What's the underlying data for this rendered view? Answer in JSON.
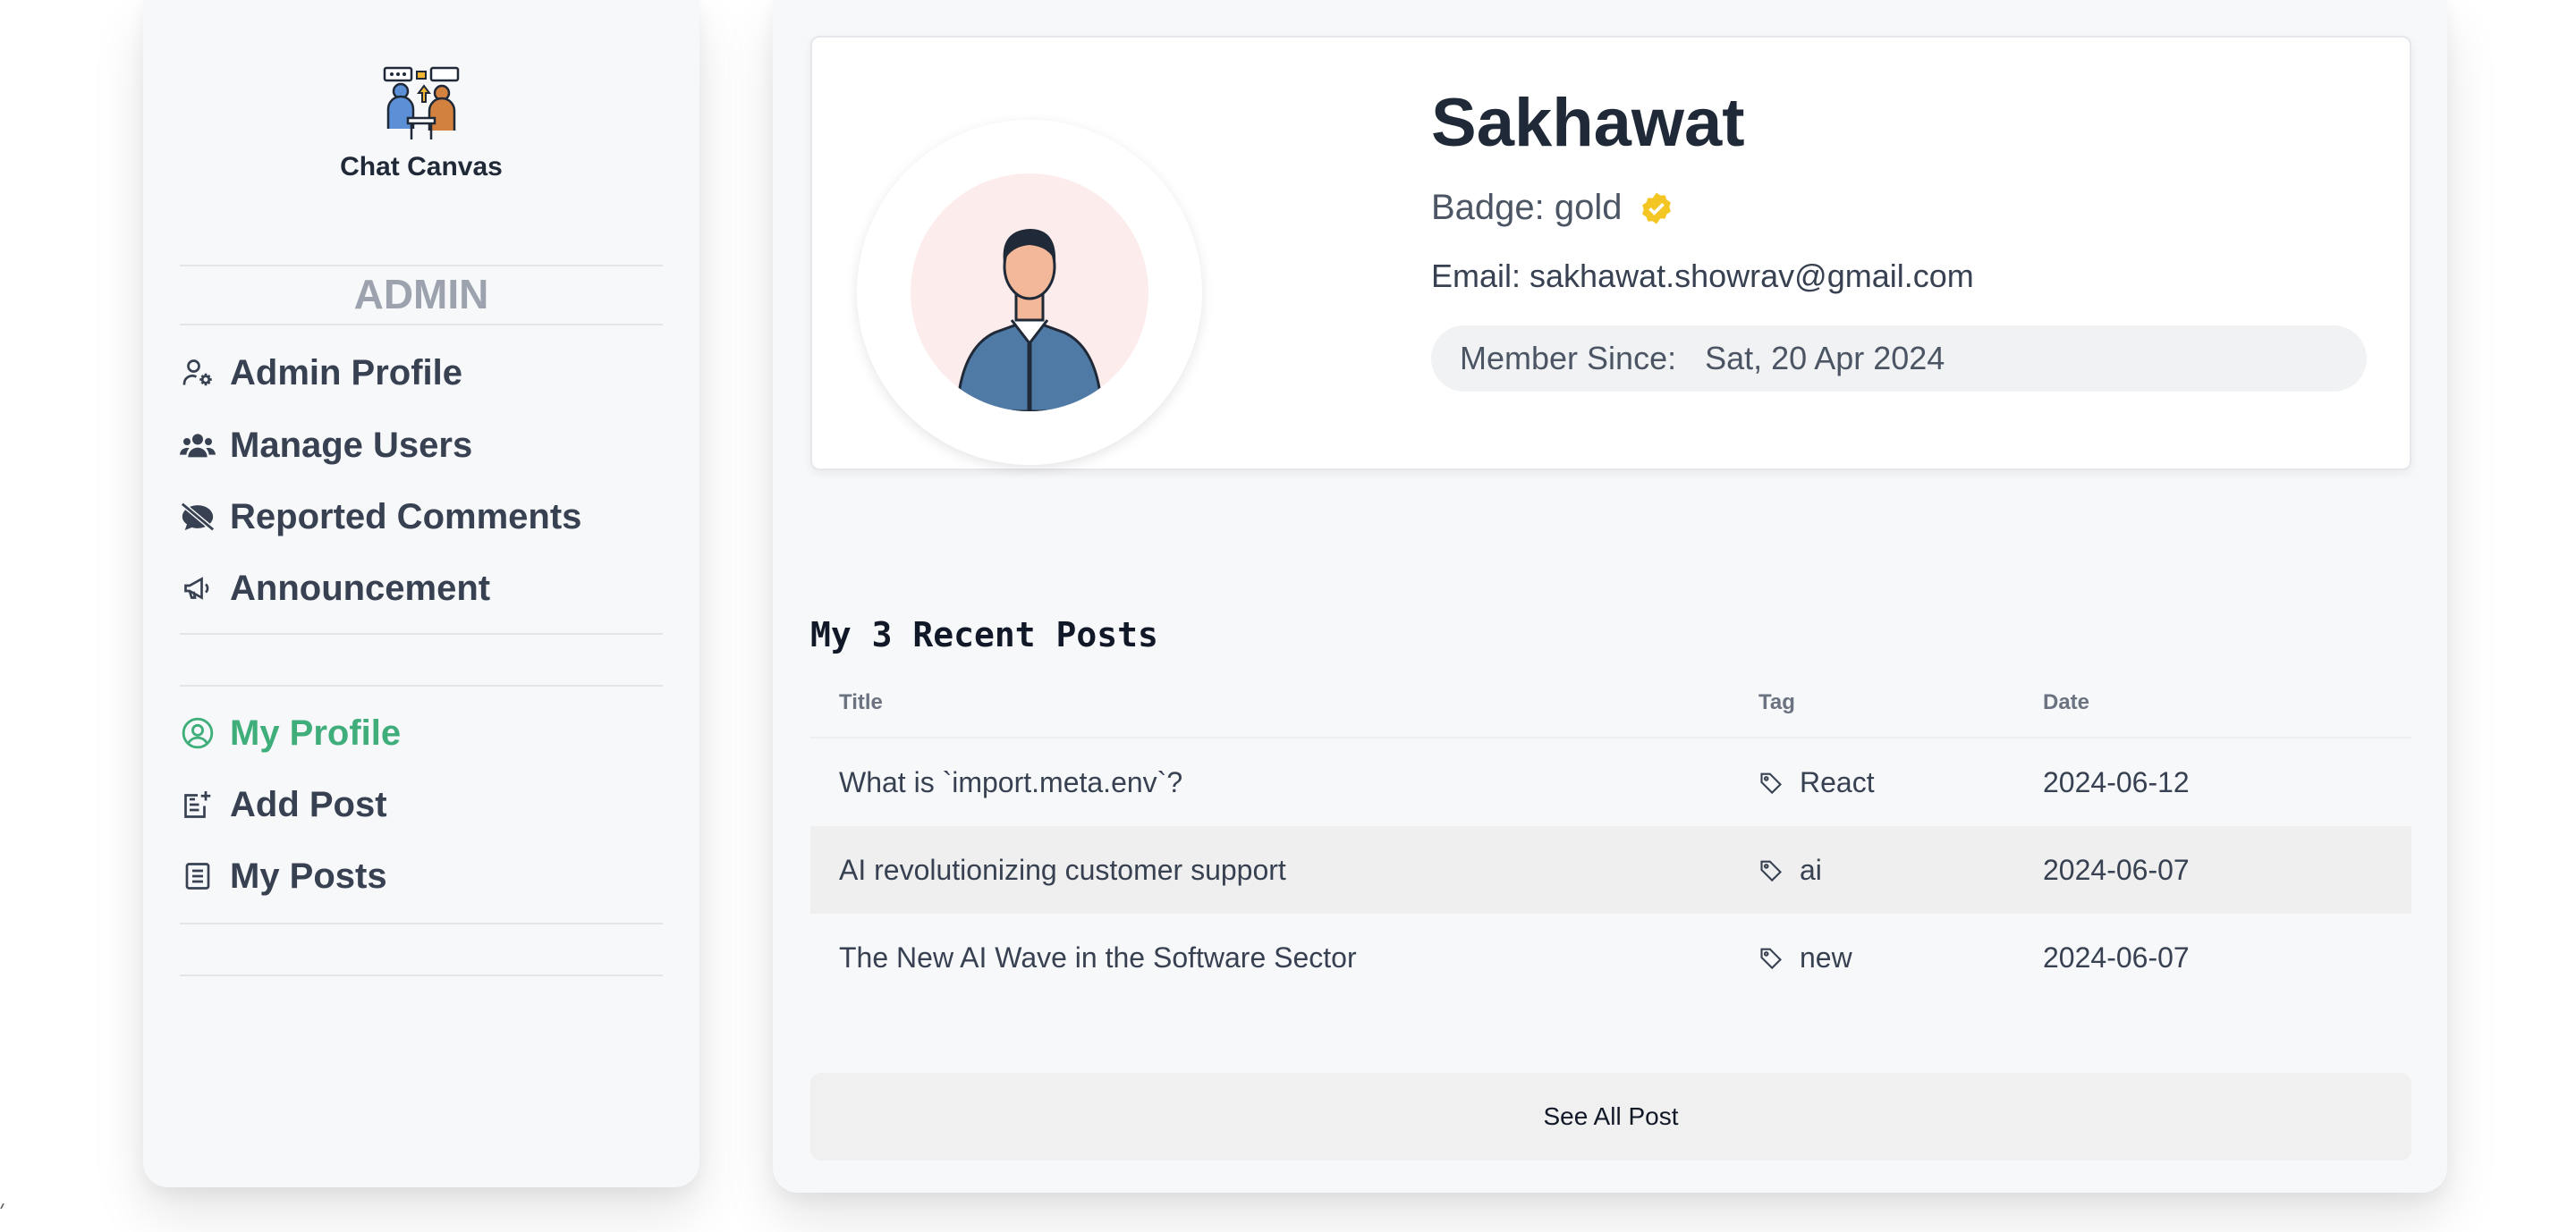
{
  "sidebar": {
    "app_name": "Chat Canvas",
    "admin_title": "ADMIN",
    "admin_items": [
      {
        "label": "Admin Profile",
        "icon": "user-gear-icon"
      },
      {
        "label": "Manage Users",
        "icon": "users-icon"
      },
      {
        "label": "Reported Comments",
        "icon": "comment-slash-icon"
      },
      {
        "label": "Announcement",
        "icon": "megaphone-icon"
      }
    ],
    "user_items": [
      {
        "label": "My Profile",
        "icon": "user-circle-icon",
        "active": true
      },
      {
        "label": "Add Post",
        "icon": "add-post-icon"
      },
      {
        "label": "My Posts",
        "icon": "posts-list-icon"
      }
    ],
    "active_color": "#3fae7a"
  },
  "profile": {
    "name": "Sakhawat",
    "badge_text": "Badge: gold",
    "badge_icon": "verified-check-icon",
    "badge_color": "#f3c623",
    "email_text": "Email: sakhawat.showrav@gmail.com",
    "member_since_label": "Member Since:",
    "member_since_value": "Sat, 20 Apr 2024"
  },
  "posts": {
    "heading": "My 3 Recent Posts",
    "columns": [
      "Title",
      "Tag",
      "Date"
    ],
    "rows": [
      {
        "title": "What is `import.meta.env`?",
        "tag": "React",
        "date": "2024-06-12"
      },
      {
        "title": "AI revolutionizing customer support",
        "tag": "ai",
        "date": "2024-06-07"
      },
      {
        "title": "The New AI Wave in the Software Sector",
        "tag": "new",
        "date": "2024-06-07"
      }
    ],
    "see_all_label": "See All Post"
  }
}
